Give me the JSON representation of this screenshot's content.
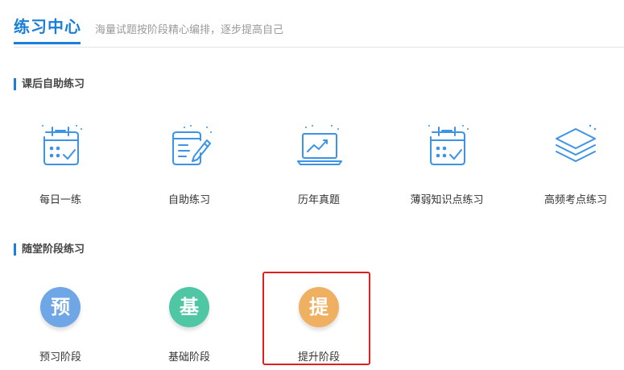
{
  "header": {
    "title": "练习中心",
    "subtitle": "海量试题按阶段精心编排，逐步提高自己"
  },
  "section1": {
    "title": "课后自助练习",
    "items": [
      {
        "label": "每日一练",
        "icon": "calendar-check-icon"
      },
      {
        "label": "自助练习",
        "icon": "document-edit-icon"
      },
      {
        "label": "历年真题",
        "icon": "chart-screen-icon"
      },
      {
        "label": "薄弱知识点练习",
        "icon": "calendar-check-icon"
      },
      {
        "label": "高频考点练习",
        "icon": "stacked-layers-icon"
      }
    ]
  },
  "section2": {
    "title": "随堂阶段练习",
    "items": [
      {
        "label": "预习阶段",
        "badge": "预",
        "color": "#6ea6e6"
      },
      {
        "label": "基础阶段",
        "badge": "基",
        "color": "#4fc6a4"
      },
      {
        "label": "提升阶段",
        "badge": "提",
        "color": "#f0b062"
      }
    ]
  },
  "colors": {
    "accent": "#1a7fd8",
    "icon_stroke": "#3d94e6",
    "highlight": "#e02020"
  }
}
